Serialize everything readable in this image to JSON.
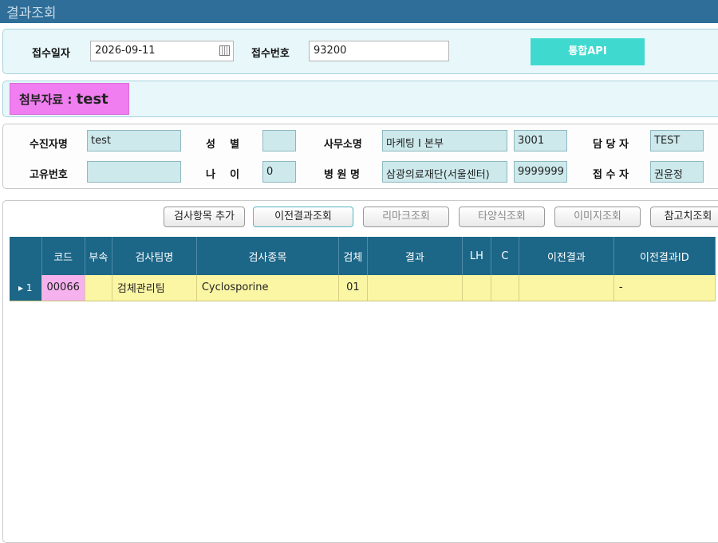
{
  "window": {
    "title": "결과조회"
  },
  "search": {
    "receipt_date_label": "접수일자",
    "receipt_date_value": "2026-09-11",
    "receipt_no_label": "접수번호",
    "receipt_no_value": "93200",
    "api_button": "통합API"
  },
  "attachment": {
    "label": "첨부자료 : ",
    "value": "test"
  },
  "patient": {
    "name_label": "수진자명",
    "name_value": "test",
    "sex_label": "성    별",
    "sex_value": "",
    "office_label": "사무소명",
    "office_value": "마케팅 I 본부",
    "office_code": "3001",
    "manager_label": "담 당 자",
    "manager_value": "TEST",
    "id_label": "고유번호",
    "id_value": "",
    "age_label": "나    이",
    "age_value": "0",
    "hospital_label": "병 원 명",
    "hospital_value": "삼광의료재단(서울센터)",
    "hospital_code": "9999999",
    "receiver_label": "접 수 자",
    "receiver_value": "권윤정"
  },
  "toolbar": {
    "add_item": "검사항목 추가",
    "prev_result": "이전결과조회",
    "remark": "리마크조회",
    "other_format": "타양식조회",
    "image": "이미지조회",
    "reference": "참고치조회"
  },
  "grid": {
    "headers": [
      "코드",
      "부속",
      "검사팀명",
      "검사종목",
      "검체",
      "결과",
      "LH",
      "C",
      "이전결과",
      "이전결과ID"
    ],
    "rows": [
      {
        "row_no": "1",
        "code": "00066",
        "sub": "",
        "team": "검체관리팀",
        "item": "Cyclosporine",
        "specimen": "01",
        "result": "",
        "lh": "",
        "c": "",
        "prev_result": "",
        "prev_result_id": "-"
      }
    ]
  }
}
